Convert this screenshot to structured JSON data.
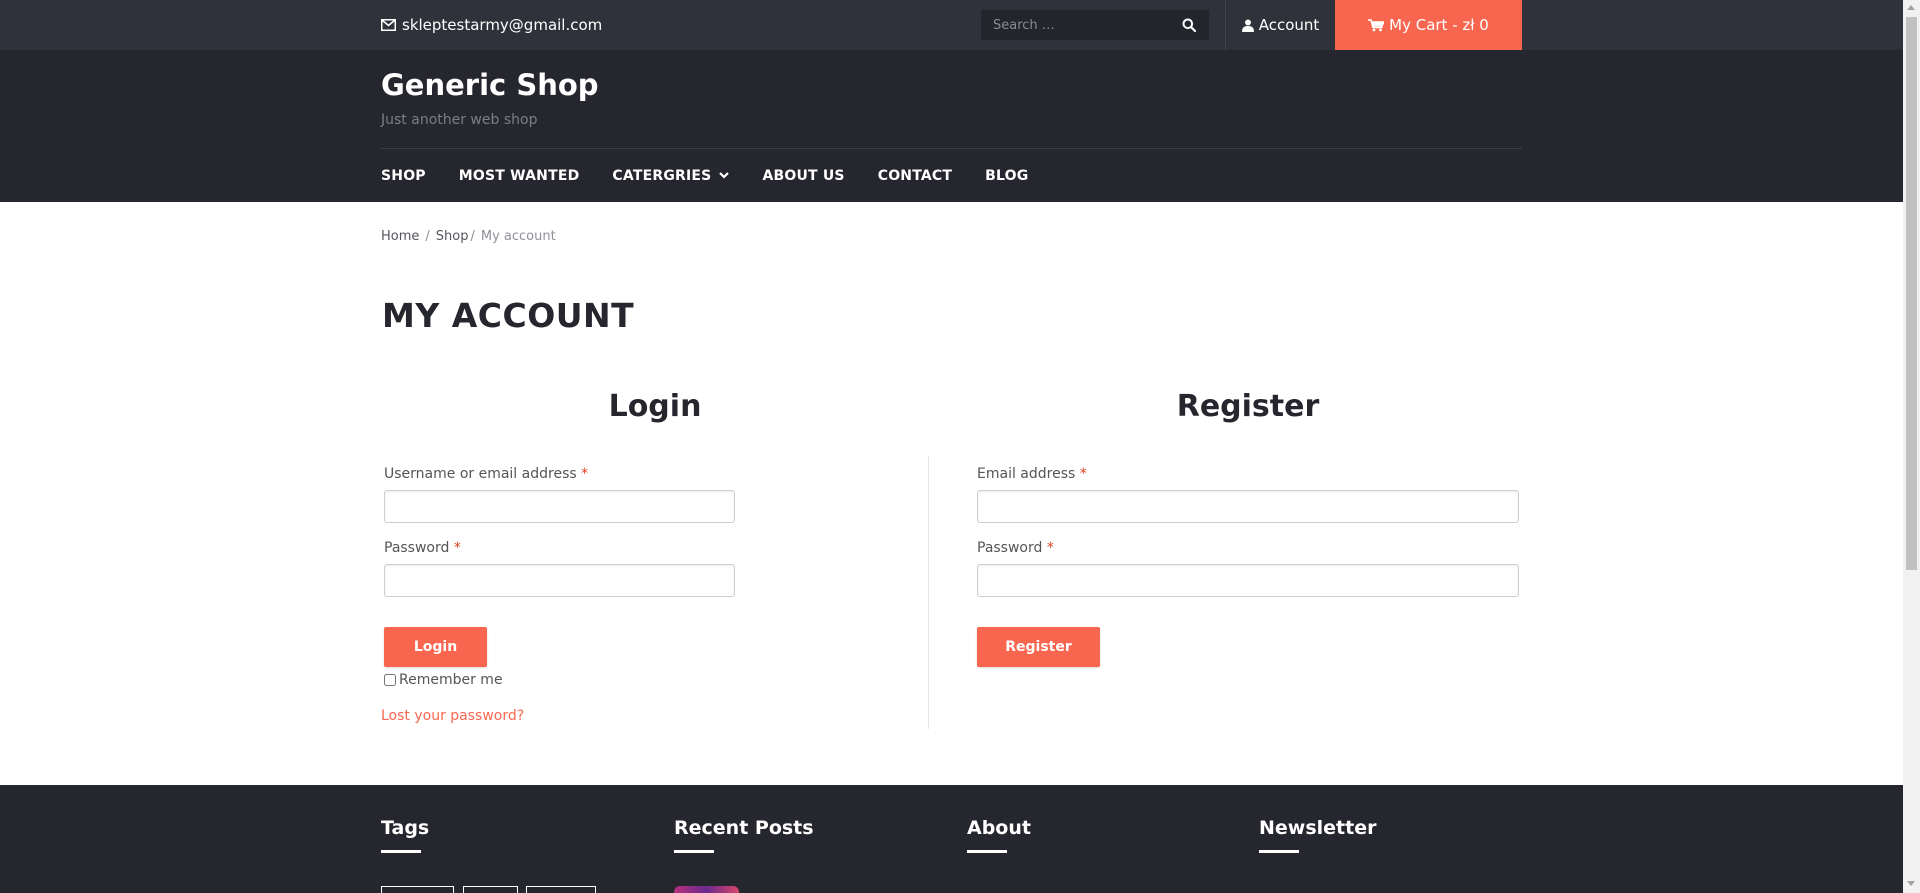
{
  "topbar": {
    "email": "skleptestarmy@gmail.com",
    "search_placeholder": "Search …",
    "account_label": "Account",
    "cart_label": "My Cart - zł 0"
  },
  "header": {
    "site_title": "Generic Shop",
    "tagline": "Just another web shop"
  },
  "nav": {
    "items": [
      {
        "label": "SHOP"
      },
      {
        "label": "MOST WANTED"
      },
      {
        "label": "CATERGRIES"
      },
      {
        "label": "ABOUT US"
      },
      {
        "label": "CONTACT"
      },
      {
        "label": "BLOG"
      }
    ]
  },
  "breadcrumb": {
    "home": "Home",
    "shop": "Shop",
    "current": "My account",
    "separator": "/"
  },
  "page": {
    "title": "MY ACCOUNT"
  },
  "login": {
    "heading": "Login",
    "username_label": "Username or email address",
    "password_label": "Password",
    "required_mark": "*",
    "submit_label": "Login",
    "remember_label": "Remember me",
    "lost_password": "Lost your password?",
    "username_value": "",
    "password_value": ""
  },
  "register": {
    "heading": "Register",
    "email_label": "Email address",
    "password_label": "Password",
    "required_mark": "*",
    "submit_label": "Register",
    "email_value": "",
    "password_value": ""
  },
  "footer": {
    "tags_title": "Tags",
    "recent_posts_title": "Recent Posts",
    "about_title": "About",
    "newsletter_title": "Newsletter"
  },
  "colors": {
    "accent": "#f96650",
    "topbar_bg": "#30323b",
    "header_bg": "#26272e",
    "required": "#e2401c"
  }
}
